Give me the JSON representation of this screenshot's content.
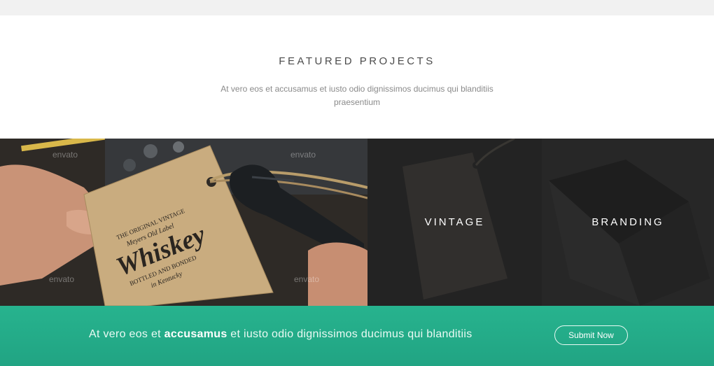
{
  "section": {
    "title": "FEATURED PROJECTS",
    "description": "At vero eos et accusamus et iusto odio dignissimos ducimus qui blanditiis praesentium"
  },
  "gallery": {
    "watermark": "envato",
    "tag_text": {
      "line1": "THE ORIGINAL VINTAGE",
      "line2": "Meyers Old Label",
      "brand": "Whiskey",
      "line3": "BOTTLED AND BONDED",
      "line4": "in Kentucky"
    },
    "tiles": [
      {
        "label": "VINTAGE",
        "icon": "tag-image"
      },
      {
        "label": "BRANDING",
        "icon": "book-image"
      }
    ]
  },
  "cta": {
    "text_pre": "At vero eos et ",
    "text_bold": "accusamus",
    "text_post": " et iusto odio dignissimos ducimus qui blanditiis",
    "button_label": "Submit Now"
  },
  "colors": {
    "accent": "#27b38e",
    "title": "#4b4b4b",
    "muted": "#8a8a8a"
  }
}
